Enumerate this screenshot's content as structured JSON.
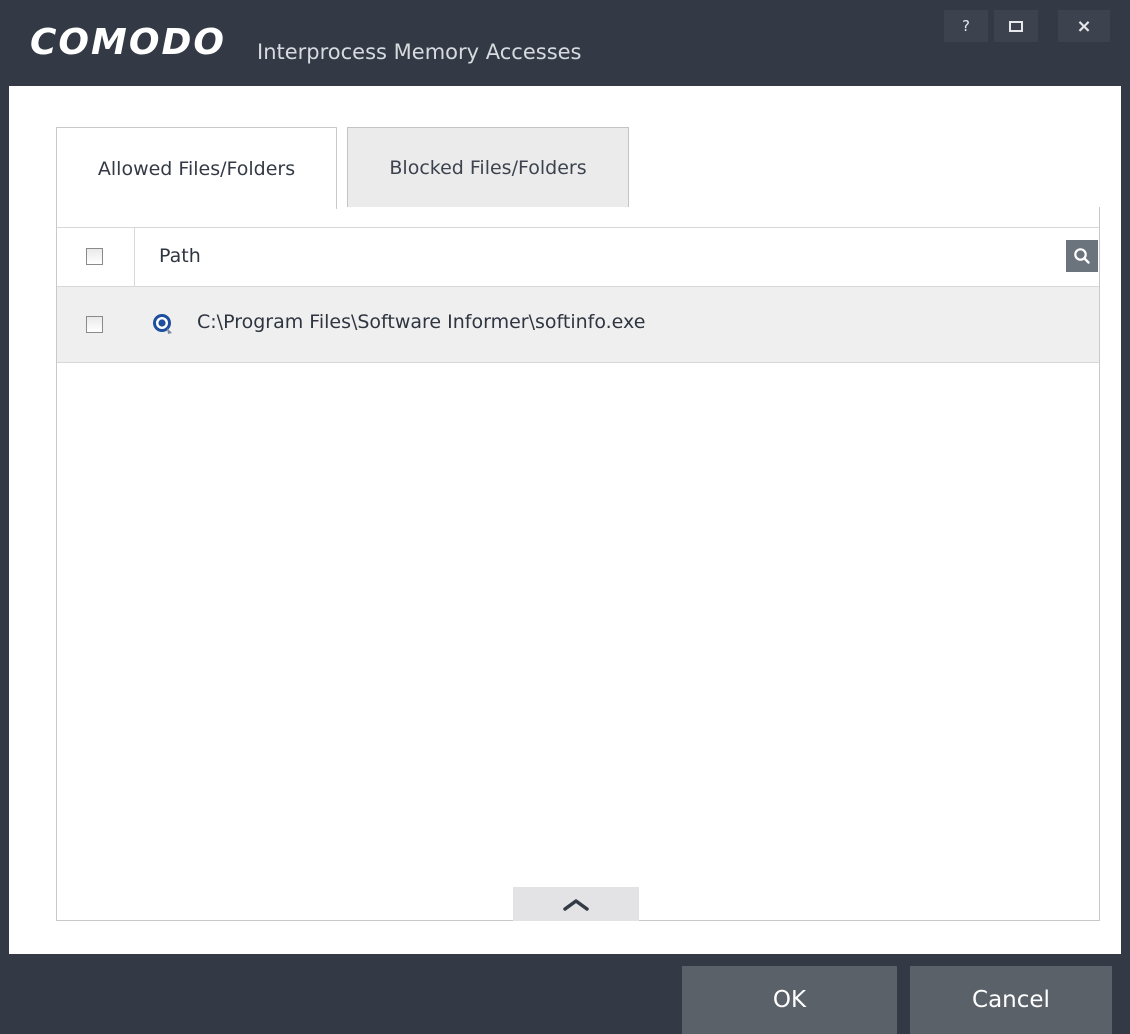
{
  "titlebar": {
    "brand": "COMODO",
    "title": "Interprocess Memory Accesses",
    "help_label": "?",
    "close_label": "×"
  },
  "tabs": [
    {
      "label": "Allowed Files/Folders",
      "active": true
    },
    {
      "label": "Blocked Files/Folders",
      "active": false
    }
  ],
  "table": {
    "column_header": "Path",
    "rows": [
      {
        "path": "C:\\Program Files\\Software Informer\\softinfo.exe",
        "icon": "app-icon",
        "checked": false
      }
    ]
  },
  "footer": {
    "ok_label": "OK",
    "cancel_label": "Cancel"
  },
  "colors": {
    "titlebar": "#333a45",
    "button": "#5a6169",
    "search_button": "#6b737c",
    "row_bg": "#efefef"
  }
}
